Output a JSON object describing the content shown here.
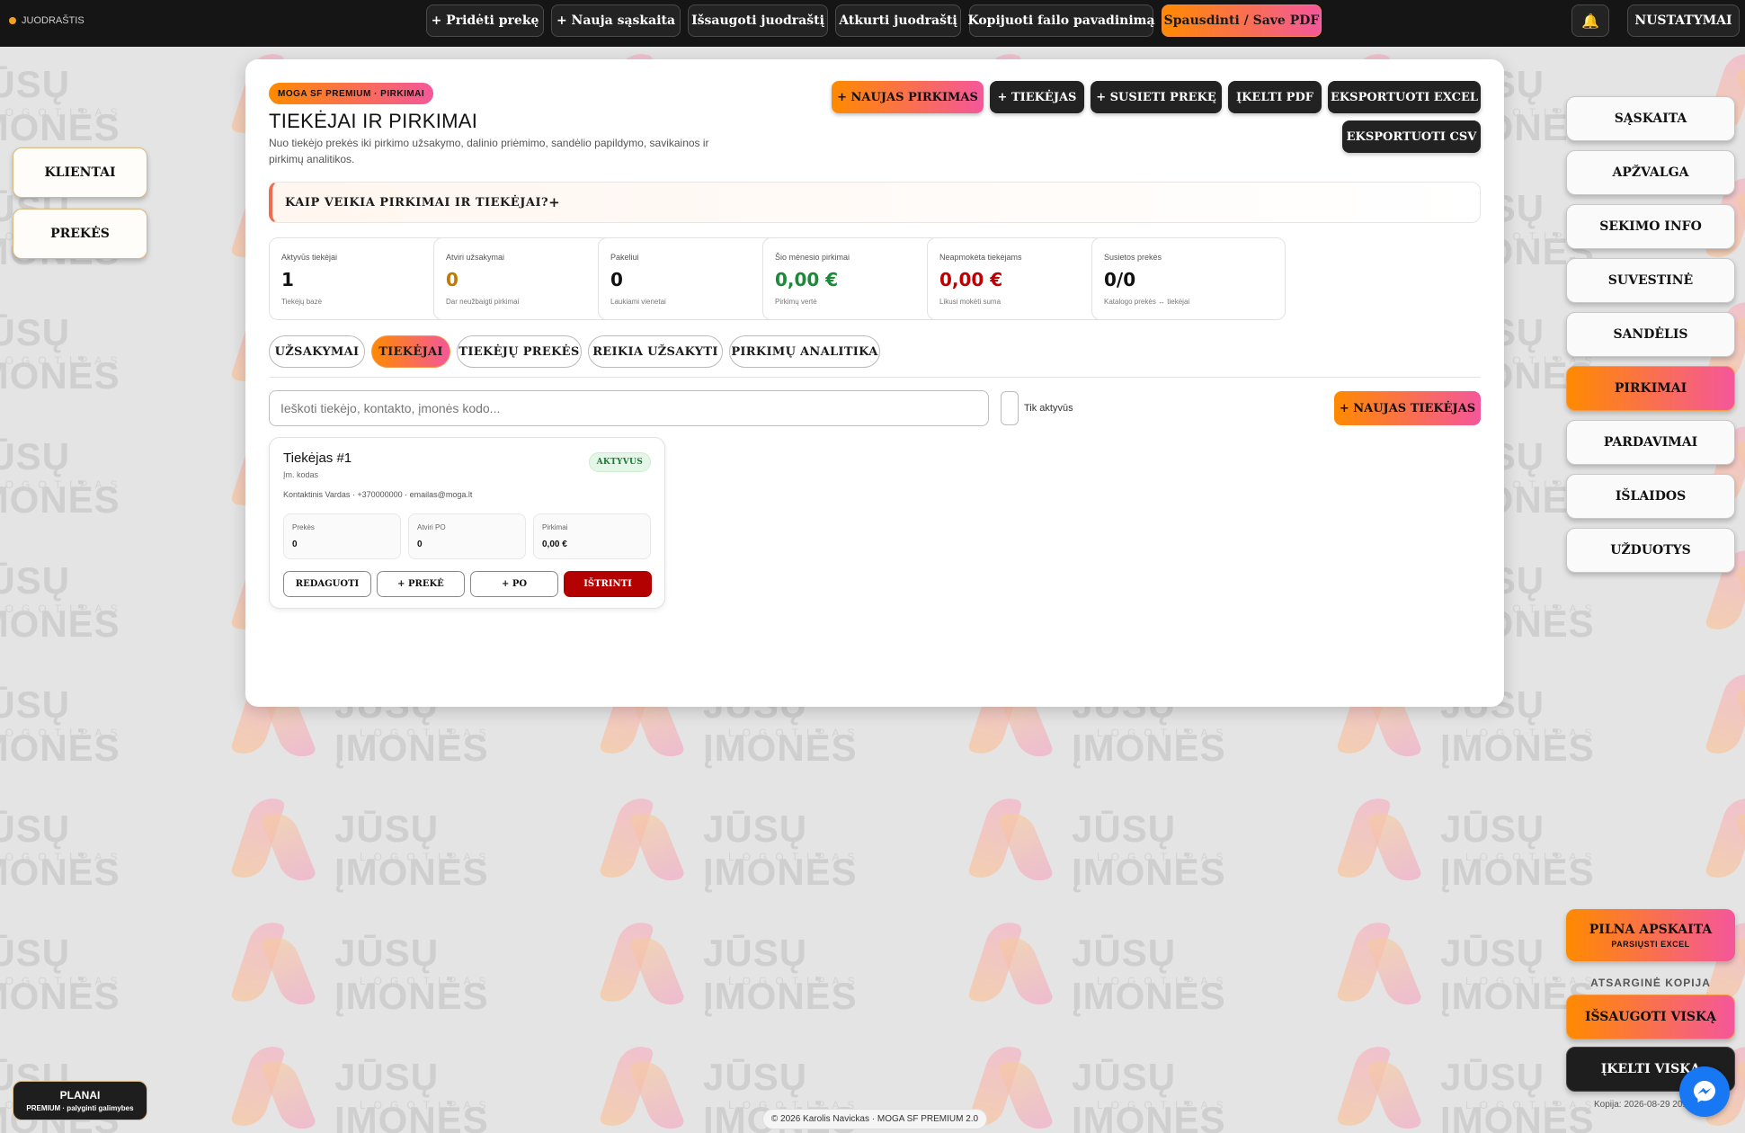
{
  "topbar": {
    "journal_label": "JUODRAŠTIS",
    "buttons": [
      "+ Pridėti prekę",
      "+ Nauja sąskaita",
      "Išsaugoti juodraštį",
      "Atkurti juodraštį",
      "Kopijuoti failo pavadinimą",
      "Spausdinti / Save PDF"
    ],
    "settings_label": "NUSTATYMAI"
  },
  "left_nav": [
    "KLIENTAI",
    "PREKĖS"
  ],
  "right_nav": [
    "SĄSKAITA",
    "APŽVALGA",
    "SEKIMO INFO",
    "SUVESTINĖ",
    "SANDĖLIS",
    "PIRKIMAI",
    "PARDAVIMAI",
    "IŠLAIDOS",
    "UŽDUOTYS"
  ],
  "right_nav_active": "PIRKIMAI",
  "bottom_right": {
    "full_accounting": "PILNA APSKAITA",
    "full_accounting_sub": "PARSIŲSTI EXCEL",
    "backup_label": "ATSARGINĖ KOPIJA",
    "save_all": "IŠSAUGOTI VISKĄ",
    "load_all": "ĮKELTI VISKĄ",
    "copy_date": "Kopija: 2026-08-29 20:"
  },
  "plans": {
    "title": "PLANAI",
    "sub": "PREMIUM · palyginti galimybes"
  },
  "footer": "© 2026 Karolis Navickas · MOGA SF PREMIUM 2.0",
  "watermark": {
    "text": "JŪSŲ ĮMONĖS",
    "sub": "LOGOTIPAS"
  },
  "main": {
    "pill": "MOGA SF PREMIUM · PIRKIMAI",
    "title": "TIEKĖJAI IR PIRKIMAI",
    "subtitle": "Nuo tiekėjo prekės iki pirkimo užsakymo, dalinio priėmimo, sandėlio papildymo, savikainos ir pirkimų analitikos.",
    "actions": [
      "+ NAUJAS PIRKIMAS",
      "+ TIEKĖJAS",
      "+ SUSIETI PREKĘ",
      "ĮKELTI PDF",
      "EKSPORTUOTI EXCEL",
      "EKSPORTUOTI CSV"
    ],
    "howto": "KAIP VEIKIA PIRKIMAI IR TIEKĖJAI?",
    "howto_icon": "+",
    "stats": [
      {
        "label": "Aktyvūs tiekėjai",
        "value": "1",
        "sub": "Tiekėjų bazė",
        "color": "#111111"
      },
      {
        "label": "Atviri užsakymai",
        "value": "0",
        "sub": "Dar neužbaigti pirkimai",
        "color": "#c07a00"
      },
      {
        "label": "Pakeliui",
        "value": "0",
        "sub": "Laukiami vienetai",
        "color": "#111111"
      },
      {
        "label": "Šio mėnesio pirkimai",
        "value": "0,00 €",
        "sub": "Pirkimų vertė",
        "color": "#1a8a3a"
      },
      {
        "label": "Neapmokėta tiekėjams",
        "value": "0,00 €",
        "sub": "Likusi mokėti suma",
        "color": "#c00000"
      },
      {
        "label": "Susietos prekės",
        "value": "0/0",
        "sub": "Katalogo prekės ↔ tiekėjai",
        "color": "#111111"
      }
    ],
    "tabs": [
      "UŽSAKYMAI",
      "TIEKĖJAI",
      "TIEKĖJŲ PREKĖS",
      "REIKIA UŽSAKYTI",
      "PIRKIMŲ ANALITIKA"
    ],
    "active_tab": "TIEKĖJAI",
    "search_placeholder": "Ieškoti tiekėjo, kontakto, įmonės kodo...",
    "only_active_label": "Tik aktyvūs",
    "new_supplier": "+ NAUJAS TIEKĖJAS",
    "supplier": {
      "name": "Tiekėjas #1",
      "code": "Įm. kodas",
      "contact": "Kontaktinis Vardas · +370000000 · emailas@moga.lt",
      "status": "AKTYVUS",
      "metrics": [
        {
          "label": "Prekės",
          "value": "0"
        },
        {
          "label": "Atviri PO",
          "value": "0"
        },
        {
          "label": "Pirkimai",
          "value": "0,00 €"
        }
      ],
      "buttons": [
        "REDAGUOTI",
        "+ PREKĖ",
        "+ PO",
        "IŠTRINTI"
      ]
    }
  }
}
